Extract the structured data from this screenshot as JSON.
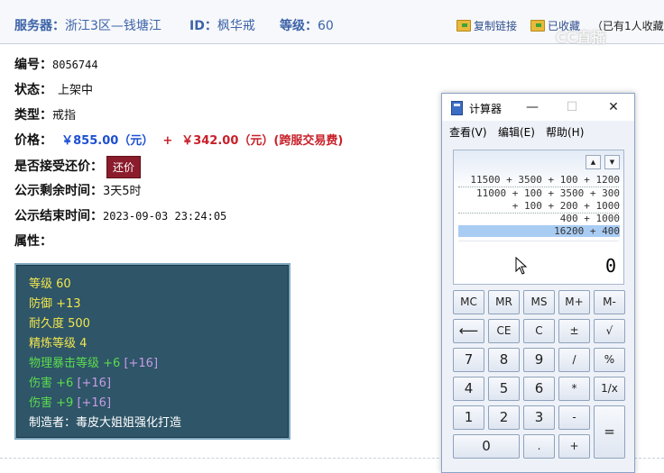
{
  "header": {
    "server_label": "服务器：",
    "server_value": "浙江3区—钱塘江",
    "id_label": "ID：",
    "id_value": "枫华戒",
    "level_label": "等级：",
    "level_value": "60",
    "copy_link": "复制链接",
    "favorited": "已收藏",
    "favorite_count": "（已有1人收藏）",
    "watermark": "CC直播"
  },
  "item": {
    "number_label": "编号：",
    "number_value": "8056744",
    "status_label": "状态：",
    "status_value": "上架中",
    "type_label": "类型：",
    "type_value": "戒指",
    "price_label": "价格：",
    "price_value": "￥855.00（元）",
    "plus": "+",
    "fee_value": "￥342.00（元）(跨服交易费)",
    "counter_label": "是否接受还价：",
    "counter_button": "还价",
    "remaining_label": "公示剩余时间：",
    "remaining_value": "3天5时",
    "end_label": "公示结束时间：",
    "end_value": "2023-09-03 23:24:05",
    "attrs_label": "属性："
  },
  "attributes": [
    {
      "text": "等级 60",
      "color": "#f2e64d"
    },
    {
      "text": "防御 +13",
      "color": "#f2e64d"
    },
    {
      "text": "耐久度 500",
      "color": "#f2e64d"
    },
    {
      "text": "精炼等级 4",
      "color": "#f2e64d"
    },
    {
      "text": "物理暴击等级 +6",
      "extra": "[+16]",
      "color": "#5bdc4e"
    },
    {
      "text": "伤害 +6",
      "extra": "[+16]",
      "color": "#5bdc4e"
    },
    {
      "text": "伤害 +9",
      "extra": "[+16]",
      "color": "#5bdc4e"
    },
    {
      "text": "制造者：毒皮大姐姐强化打造",
      "color": "#ffffff"
    }
  ],
  "calculator": {
    "title": "计算器",
    "menu": [
      "查看(V)",
      "编辑(E)",
      "帮助(H)"
    ],
    "history": [
      "11500 + 3500 + 100 + 1200",
      "11000 + 100 + 3500 + 300",
      "+ 100 + 200 + 1000",
      "400 + 1000",
      "16200 + 400"
    ],
    "result": "0",
    "keys": {
      "mc": "MC",
      "mr": "MR",
      "ms": "MS",
      "mplus": "M+",
      "mminus": "M-",
      "back": "⟵",
      "ce": "CE",
      "c": "C",
      "pm": "±",
      "sqrt": "√",
      "k7": "7",
      "k8": "8",
      "k9": "9",
      "div": "/",
      "pct": "%",
      "k4": "4",
      "k5": "5",
      "k6": "6",
      "mul": "*",
      "inv": "1/x",
      "k1": "1",
      "k2": "2",
      "k3": "3",
      "sub": "-",
      "eq": "=",
      "k0": "0",
      "dot": ".",
      "add": "+"
    }
  }
}
